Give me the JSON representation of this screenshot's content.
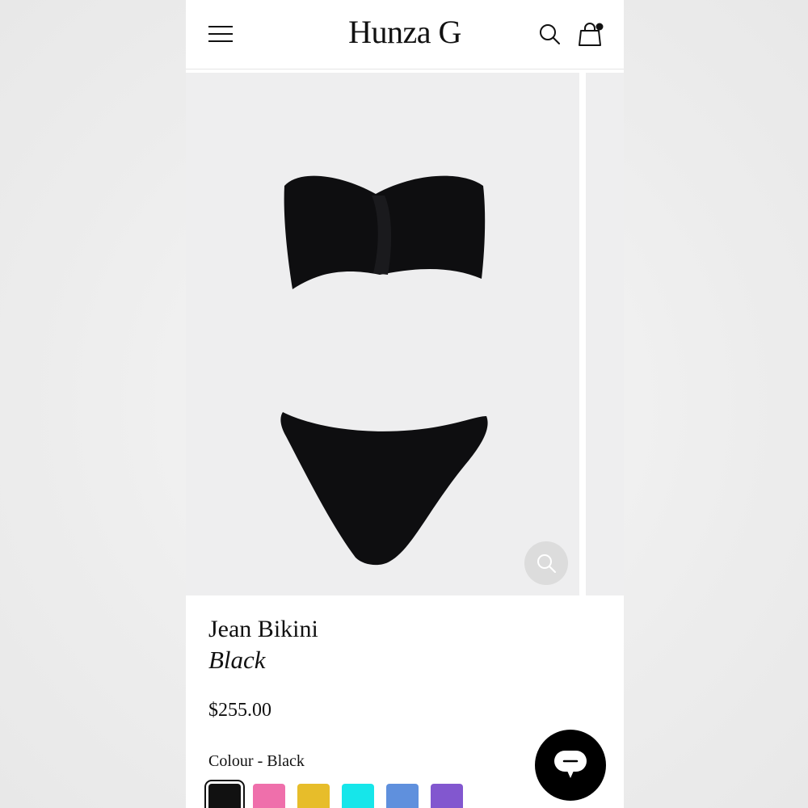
{
  "header": {
    "logo": "Hunza G",
    "menu_icon": "hamburger-menu-icon",
    "search_icon": "search-icon",
    "bag_icon": "shopping-bag-icon",
    "bag_has_items": true
  },
  "gallery": {
    "image_alt": "Black strapless bikini top and bottom",
    "zoom_icon": "zoom-icon"
  },
  "product": {
    "name": "Jean Bikini",
    "colour_name": "Black",
    "price": "$255.00",
    "colour_label": "Colour",
    "colour_separator": " - ",
    "selected_colour": "Black"
  },
  "swatches": [
    {
      "color": "#111111",
      "selected": true
    },
    {
      "color": "#ef6fab",
      "selected": false
    },
    {
      "color": "#e7bd2a",
      "selected": false
    },
    {
      "color": "#16e6ea",
      "selected": false
    },
    {
      "color": "#5f90dd",
      "selected": false
    },
    {
      "color": "#8257cf",
      "selected": false
    }
  ],
  "chat": {
    "icon": "chat-bubble-icon"
  }
}
